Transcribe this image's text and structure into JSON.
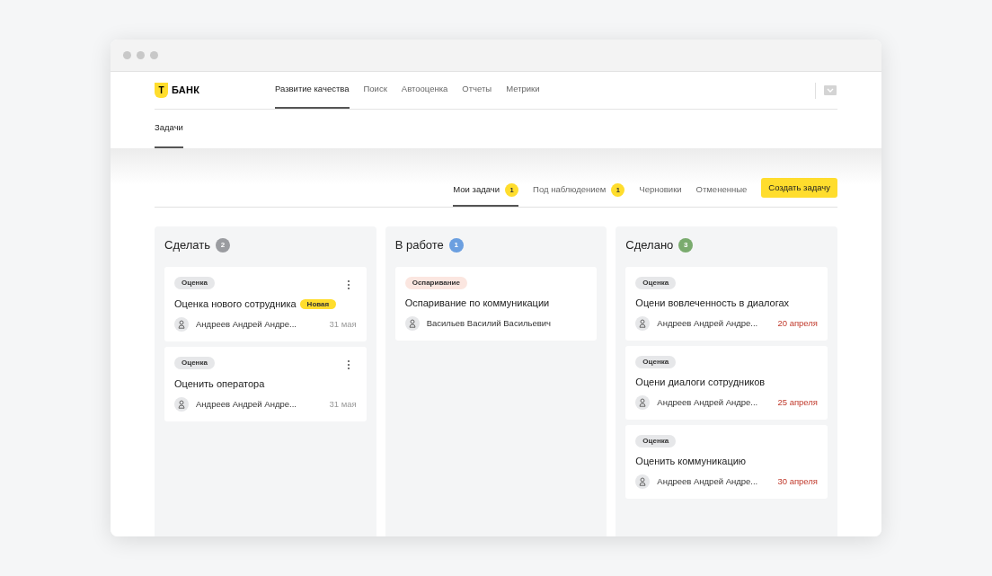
{
  "logo": {
    "mark": "Т",
    "name": "БАНК"
  },
  "nav": [
    {
      "label": "Развитие качества",
      "selected": true
    },
    {
      "label": "Поиск",
      "selected": false
    },
    {
      "label": "Автооценка",
      "selected": false
    },
    {
      "label": "Отчеты",
      "selected": false
    },
    {
      "label": "Метрики",
      "selected": false
    }
  ],
  "subnav": [
    {
      "label": "Задачи",
      "selected": true
    }
  ],
  "tabs": [
    {
      "label": "Мои задачи",
      "count": "1",
      "selected": true
    },
    {
      "label": "Под наблюдением",
      "count": "1",
      "selected": false
    },
    {
      "label": "Черновики",
      "selected": false
    },
    {
      "label": "Отмененные",
      "selected": false
    }
  ],
  "create_button": "Создать задачу",
  "columns": [
    {
      "title": "Сделать",
      "count": "2",
      "color": "#9a9ca0",
      "cards": [
        {
          "tag": {
            "kind": "evaluation",
            "label": "Оценка"
          },
          "title": "Оценка нового сотрудника",
          "badge": "Новая",
          "has_menu": true,
          "assignee": "Андреев Андрей Андре...",
          "date": "31 мая",
          "overdue": false
        },
        {
          "tag": {
            "kind": "evaluation",
            "label": "Оценка"
          },
          "title": "Оценить оператора",
          "has_menu": true,
          "assignee": "Андреев Андрей Андре...",
          "date": "31 мая",
          "overdue": false
        }
      ]
    },
    {
      "title": "В работе",
      "count": "1",
      "color": "#6b9fe0",
      "cards": [
        {
          "tag": {
            "kind": "dispute",
            "label": "Оспаривание"
          },
          "title": "Оспаривание по коммуникации",
          "has_menu": false,
          "assignee": "Васильев Василий Васильевич"
        }
      ]
    },
    {
      "title": "Сделано",
      "count": "3",
      "color": "#7aab6e",
      "cards": [
        {
          "tag": {
            "kind": "evaluation",
            "label": "Оценка"
          },
          "title": "Оцени вовлеченность в диалогах",
          "has_menu": false,
          "assignee": "Андреев Андрей Андре...",
          "date": "20 апреля",
          "overdue": true
        },
        {
          "tag": {
            "kind": "evaluation",
            "label": "Оценка"
          },
          "title": "Оцени диалоги сотрудников",
          "has_menu": false,
          "assignee": "Андреев Андрей Андре...",
          "date": "25 апреля",
          "overdue": true
        },
        {
          "tag": {
            "kind": "evaluation",
            "label": "Оценка"
          },
          "title": "Оценить коммуникацию",
          "has_menu": false,
          "assignee": "Андреев Андрей Андре...",
          "date": "30 апреля",
          "overdue": true
        }
      ]
    }
  ]
}
